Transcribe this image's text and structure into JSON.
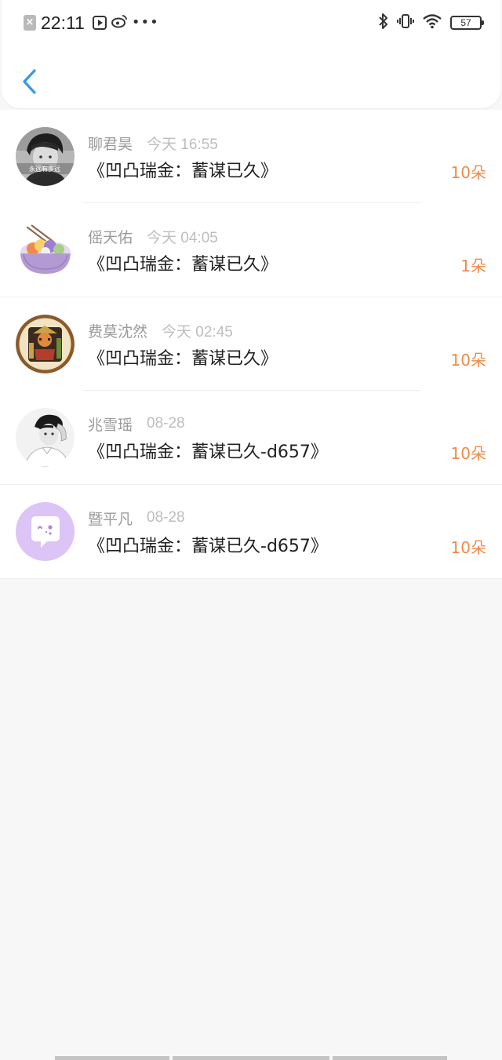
{
  "status_bar": {
    "time": "22:11",
    "battery": "57",
    "icons": [
      "close-notification-icon",
      "video-app-icon",
      "weibo-icon",
      "more-dots-icon",
      "bluetooth-icon",
      "vibrate-icon",
      "wifi-icon",
      "battery-icon"
    ]
  },
  "header": {
    "back_icon": "chevron-left-icon",
    "accent_color": "#2f9be8"
  },
  "colors": {
    "count_color": "#ef8a4a",
    "name_color": "#9a9a9a",
    "title_color": "#222222"
  },
  "gifts": [
    {
      "name": "聊君昊",
      "time": "今天 16:55",
      "title": "《凹凸瑞金：蓄谋已久》",
      "count": "10朵",
      "avatar": "boy-photo-avatar",
      "avatar_caption": "永远有多远"
    },
    {
      "name": "傜天佑",
      "time": "今天 04:05",
      "title": "《凹凸瑞金：蓄谋已久》",
      "count": "1朵",
      "avatar": "food-bowl-avatar"
    },
    {
      "name": "费莫沈然",
      "time": "今天 02:45",
      "title": "《凹凸瑞金：蓄谋已久》",
      "count": "10朵",
      "avatar": "warrior-badge-avatar"
    },
    {
      "name": "兆雪瑶",
      "time": "08-28",
      "title": "《凹凸瑞金：蓄谋已久-d657》",
      "count": "10朵",
      "avatar": "man-sketch-avatar"
    },
    {
      "name": "暨平凡",
      "time": "08-28",
      "title": "《凹凸瑞金：蓄谋已久-d657》",
      "count": "10朵",
      "avatar": "purple-chat-avatar"
    }
  ]
}
